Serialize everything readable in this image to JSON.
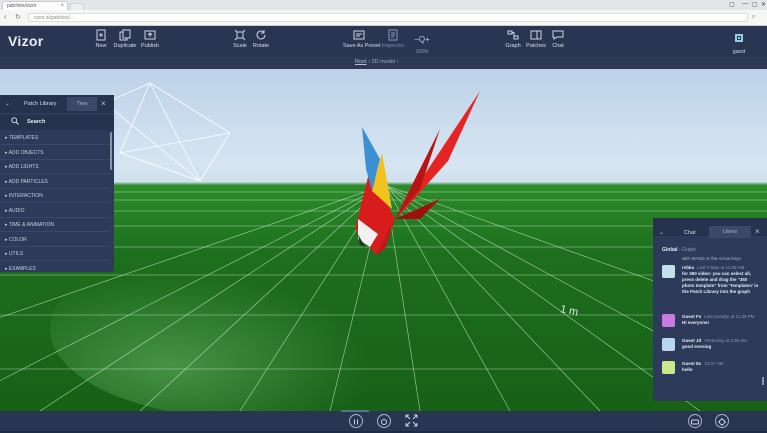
{
  "browser": {
    "tab_title": "patches/vizor",
    "tab_close": "×",
    "url": "vizor.io/patches/...",
    "window_controls": [
      "▢",
      "—",
      "▢",
      "✕"
    ]
  },
  "toolbar": {
    "logo": "Vizor",
    "tools": [
      {
        "label": "New",
        "icon": "new-icon"
      },
      {
        "label": "Duplicate",
        "icon": "duplicate-icon"
      },
      {
        "label": "Publish",
        "icon": "publish-icon"
      },
      {
        "label": "Scale",
        "icon": "scale-icon"
      },
      {
        "label": "Rotate",
        "icon": "rotate-icon"
      },
      {
        "label": "Save As Preset",
        "icon": "save-preset-icon"
      },
      {
        "label": "Inspector",
        "icon": "inspector-icon"
      },
      {
        "label": "Graph",
        "icon": "graph-icon"
      },
      {
        "label": "Patches",
        "icon": "patches-icon"
      },
      {
        "label": "Chat",
        "icon": "chat-icon"
      }
    ],
    "zoom": {
      "symbol": "−Q+",
      "value": "100%"
    },
    "user": "guest"
  },
  "breadcrumb": {
    "root": "Root",
    "separator": "›",
    "current": "3D model",
    "trailing": "›"
  },
  "viewport": {
    "scale_label": "1 m",
    "sky_color": "#cfe0ee",
    "ground_color": "#1f7a1f"
  },
  "patch_library": {
    "title": "Patch Library",
    "tree_tab": "Tree",
    "close": "×",
    "search_label": "Search",
    "categories": [
      "TEMPLATES",
      "ADD OBJECTS",
      "ADD LIGHTS",
      "ADD PARTICLES",
      "INTERACTION",
      "AUDIO",
      "TIME & ANIMATION",
      "COLOR",
      "UTILS",
      "EXAMPLES"
    ]
  },
  "chat": {
    "title": "Chat",
    "users_tab": "Users",
    "close": "×",
    "tabs": {
      "global": "Global",
      "separator": "›",
      "graph": "Graph"
    },
    "partial_line": "with WASD or the Arrow keys",
    "messages": [
      {
        "name": "rebka",
        "time": "Last Friday at 11:28 AM",
        "text": "for 360 video: you can select all, press delete and drag the \"360 photo template\" from 'Templates' in the Patch Library into the graph",
        "avatar_color": "#bfe3e8"
      },
      {
        "name": "Guest Fs",
        "time": "Last Sunday at 11:38 PM",
        "text": "Hi everyone!",
        "avatar_color": "#c77be0"
      },
      {
        "name": "Guest Jd",
        "time": "Yesterday at 2:55 AM",
        "text": "good evening",
        "avatar_color": "#b9d6f0"
      },
      {
        "name": "Guest 8o",
        "time": "10:37 AM",
        "text": "hello",
        "avatar_color": "#cde88a"
      }
    ]
  },
  "bottombar": {
    "buttons": [
      "pause-icon",
      "stop-icon",
      "fullscreen-icon",
      "vr-icon",
      "share-icon"
    ]
  }
}
